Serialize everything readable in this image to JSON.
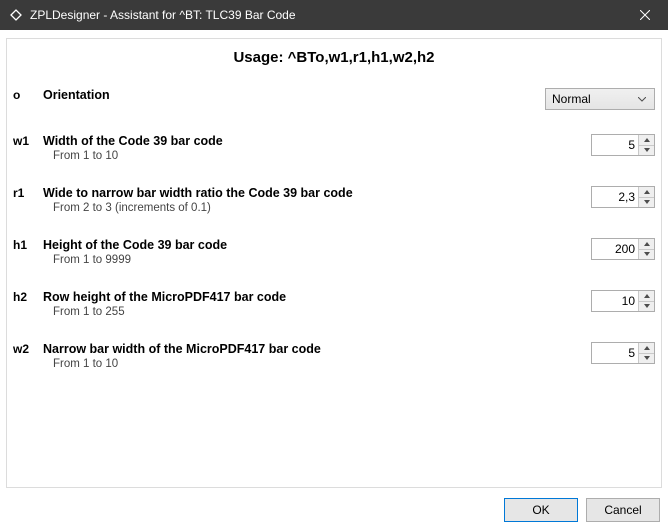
{
  "window": {
    "title": "ZPLDesigner - Assistant for ^BT: TLC39 Bar Code"
  },
  "usage": "Usage: ^BTo,w1,r1,h1,w2,h2",
  "params": {
    "o": {
      "code": "o",
      "label": "Orientation",
      "range": ""
    },
    "w1": {
      "code": "w1",
      "label": "Width of the Code 39 bar code",
      "range": "From 1 to 10"
    },
    "r1": {
      "code": "r1",
      "label": "Wide to narrow bar width ratio the Code 39 bar code",
      "range": "From 2 to 3 (increments of 0.1)"
    },
    "h1": {
      "code": "h1",
      "label": "Height of the Code 39 bar code",
      "range": "From 1 to 9999"
    },
    "h2": {
      "code": "h2",
      "label": "Row height of the MicroPDF417 bar code",
      "range": "From 1 to 255"
    },
    "w2": {
      "code": "w2",
      "label": "Narrow bar width of the MicroPDF417 bar code",
      "range": "From 1 to 10"
    }
  },
  "values": {
    "orientation": "Normal",
    "w1": "5",
    "r1": "2,3",
    "h1": "200",
    "h2": "10",
    "w2": "5"
  },
  "buttons": {
    "ok": "OK",
    "cancel": "Cancel"
  }
}
